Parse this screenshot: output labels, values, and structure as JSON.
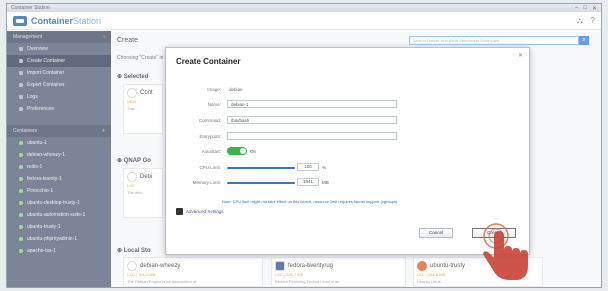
{
  "window": {
    "title": "Container Station",
    "controls": [
      "–",
      "□",
      "✕"
    ]
  },
  "app": {
    "name_a": "Container",
    "name_b": "Station",
    "right_icons": [
      "⛬",
      "?"
    ]
  },
  "sidebar": {
    "management_header": "Management",
    "management_items": [
      "Overview",
      "Create Container",
      "Import Container",
      "Export Container",
      "Logs",
      "Preferences"
    ],
    "containers_header": "Containers",
    "container_items": [
      "ubuntu-1",
      "debian-wheezy-1",
      "redis-1",
      "fedora-twenty-1",
      "Pinocchio-1",
      "ubuntu-desktop-trusty-1",
      "ubuntu-automation-suite-1",
      "ubuntu-trusty-1",
      "ubuntu-phpmyadmin-1",
      "apache-tss-1"
    ]
  },
  "main": {
    "crumb": "Create",
    "search_placeholder": "Search Docker Hub (Built Selected to Download)",
    "search_icon": "search-icon",
    "choosing": "Choosing \"Create\" in",
    "section1": "Selected",
    "section2": "QNAP Go",
    "section3": "Local Sto",
    "card_top1": {
      "title": "Cont",
      "sub": "NEW",
      "desc": "This..."
    },
    "card_top2": {
      "title": "Debi",
      "sub": "LXC",
      "desc": "The deb..."
    },
    "bottom_cards": [
      {
        "title": "debian-wheezy",
        "sub": "LXC",
        "size": "166.2 MB",
        "desc": "The Debian Project is an association of"
      },
      {
        "title": "fedora-twentyrug",
        "sub": "LXC",
        "size": "205.7 MB",
        "desc": "Fedora Remixing Fedora Linux is an"
      },
      {
        "title": "ubuntu-trusty",
        "sub": "LXC",
        "size": "284.8 MB",
        "desc": "Ubuntu Linux"
      }
    ]
  },
  "dialog": {
    "title": "Create Container",
    "close_label": "✕",
    "image_label": "Image:",
    "image_value": "debian",
    "name_label": "Name:",
    "name_value": "debian-1",
    "command_label": "Command:",
    "command_value": "/bin/bash",
    "entrypoint_label": "Entrypoint:",
    "entrypoint_value": "",
    "autostart_label": "Autostart:",
    "autostart_on": "On",
    "cpu_label": "CPU Limit:",
    "cpu_value": "100",
    "cpu_unit": "%",
    "cpu_fill": 0.9,
    "mem_label": "Memory Limit:",
    "mem_value": "1841",
    "mem_unit": "MB",
    "mem_fill": 0.9,
    "note": "Note: CPU limit might not take effect on this kernel, resource limit requires kernel support (cgroups).",
    "advanced_label": "Advanced Settings",
    "cancel_label": "Cancel",
    "create_label": "Create"
  }
}
